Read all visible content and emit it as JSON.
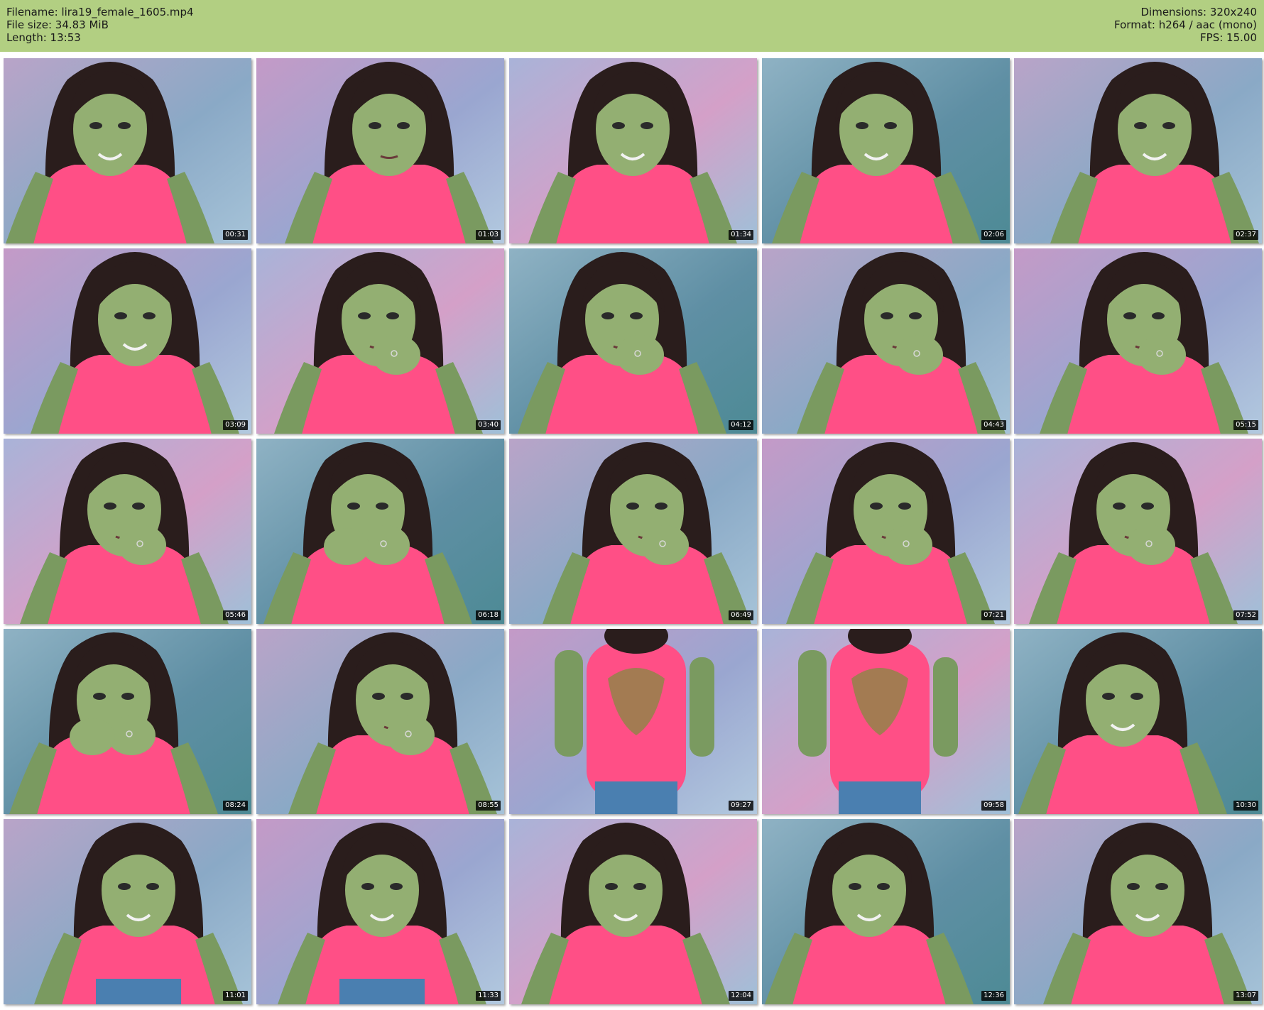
{
  "header": {
    "filename_line": "Filename: lira19_female_1605.mp4",
    "filesize_line": "File size: 34.83 MiB",
    "length_line": "Length: 13:53",
    "dimensions_line": "Dimensions: 320x240",
    "format_line": "Format: h264 / aac (mono)",
    "fps_line": "FPS: 15.00"
  },
  "colors": {
    "header_bg": "#b2cf82",
    "page_bg": "#ffffff",
    "timestamp_bg": "#000000",
    "shirt": "#ff4f86",
    "hair": "#2a1d1c"
  },
  "thumbnails": [
    {
      "timestamp": "00:31",
      "pose": "close-smile"
    },
    {
      "timestamp": "01:03",
      "pose": "close-down"
    },
    {
      "timestamp": "01:34",
      "pose": "close-smile"
    },
    {
      "timestamp": "02:06",
      "pose": "close-smile"
    },
    {
      "timestamp": "02:37",
      "pose": "close-smile"
    },
    {
      "timestamp": "03:09",
      "pose": "close-smile"
    },
    {
      "timestamp": "03:40",
      "pose": "hand-chin"
    },
    {
      "timestamp": "04:12",
      "pose": "hand-chin"
    },
    {
      "timestamp": "04:43",
      "pose": "hand-chin"
    },
    {
      "timestamp": "05:15",
      "pose": "hand-chin"
    },
    {
      "timestamp": "05:46",
      "pose": "hand-chin"
    },
    {
      "timestamp": "06:18",
      "pose": "hands-folded"
    },
    {
      "timestamp": "06:49",
      "pose": "hand-chin"
    },
    {
      "timestamp": "07:21",
      "pose": "hand-chin"
    },
    {
      "timestamp": "07:52",
      "pose": "hand-chin"
    },
    {
      "timestamp": "08:24",
      "pose": "hands-face"
    },
    {
      "timestamp": "08:55",
      "pose": "hand-chin"
    },
    {
      "timestamp": "09:27",
      "pose": "standing"
    },
    {
      "timestamp": "09:58",
      "pose": "standing"
    },
    {
      "timestamp": "10:30",
      "pose": "close-smile"
    },
    {
      "timestamp": "11:01",
      "pose": "leaning"
    },
    {
      "timestamp": "11:33",
      "pose": "leaning"
    },
    {
      "timestamp": "12:04",
      "pose": "close-smile"
    },
    {
      "timestamp": "12:36",
      "pose": "close-smile"
    },
    {
      "timestamp": "13:07",
      "pose": "close-smile"
    }
  ]
}
